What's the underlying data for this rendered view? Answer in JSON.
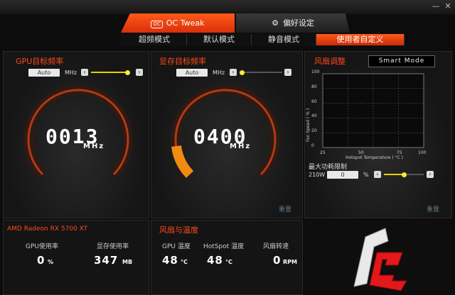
{
  "window": {
    "minimize": "—",
    "close": "✕"
  },
  "tabs": {
    "oc_tweak": "OC Tweak",
    "preference": "偏好设定"
  },
  "modes": [
    "超频模式",
    "默认模式",
    "静音模式",
    "使用者自定义"
  ],
  "gpu_panel": {
    "title": "GPU目标频率",
    "auto": "Auto",
    "unit": "MHz",
    "value": "0013",
    "big_unit": "MHz",
    "slider_fraction": 1.0
  },
  "mem_panel": {
    "title": "显存目标频率",
    "auto": "Auto",
    "unit": "MHz",
    "value": "0400",
    "big_unit": "MHz",
    "slider_fraction": 0.0,
    "reset": "重置"
  },
  "fan_panel": {
    "title": "风扇调整",
    "mode": "Smart Mode",
    "reset": "重置",
    "power_label": "最大功耗限制",
    "power_value": "210W",
    "power_input": "0",
    "power_unit": "%",
    "chart": {
      "ylabel": "Fan Speed ( % )",
      "xlabel": "Hotspot Temperature ( °C )",
      "yticks": [
        "100",
        "80",
        "60",
        "40",
        "20",
        "0"
      ],
      "xticks": [
        "25",
        "50",
        "75",
        "100"
      ]
    }
  },
  "chart_data": {
    "type": "line",
    "title": "",
    "xlabel": "Hotspot Temperature ( °C )",
    "ylabel": "Fan Speed ( % )",
    "xlim": [
      25,
      100
    ],
    "ylim": [
      0,
      100
    ],
    "grid": true,
    "series": []
  },
  "gpu_info": {
    "name": "AMD Radeon RX 5700 XT",
    "gpu_usage_label": "GPU使用率",
    "gpu_usage": "0",
    "gpu_usage_unit": "%",
    "mem_usage_label": "显存使用率",
    "mem_usage": "347",
    "mem_usage_unit": "MB"
  },
  "fan_temp": {
    "title": "风扇与温度",
    "gpu_temp_label": "GPU 温度",
    "gpu_temp": "48",
    "hotspot_label": "HotSpot 温度",
    "hotspot_temp": "48",
    "temp_unit": "°C",
    "fan_label": "风扇转速",
    "fan_rpm": "0",
    "rpm_unit": "RPM"
  },
  "colors": {
    "accent": "#ff4a1a",
    "slider": "#ffe83a",
    "reset": "#5c7a90"
  }
}
